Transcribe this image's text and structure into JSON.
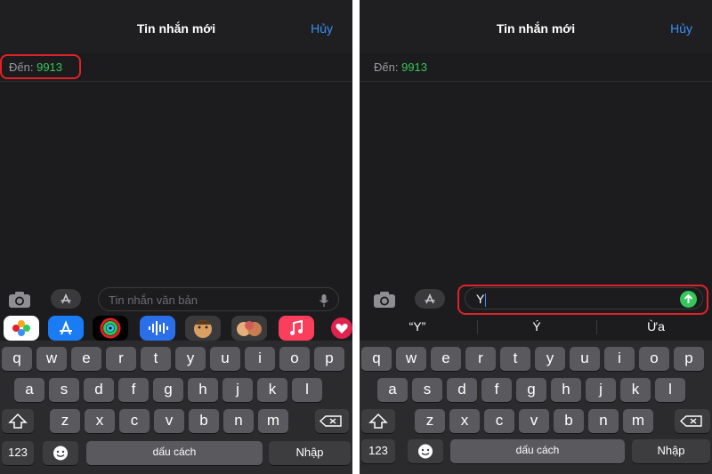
{
  "colors": {
    "accent": "#3a8ef6",
    "recipient": "#34c759",
    "highlight": "#e0222a",
    "send": "#34c759"
  },
  "left": {
    "header": {
      "title": "Tin nhắn mới",
      "cancel": "Hủy"
    },
    "to": {
      "label": "Đến:",
      "value": "9913"
    },
    "input": {
      "placeholder": "Tin nhắn văn bản"
    },
    "app_strip": [
      "photos-icon",
      "app-store-icon",
      "activity-icon",
      "audio-icon",
      "memoji-icon",
      "memoji-group-icon",
      "music-icon",
      "heart-icon"
    ],
    "keyboard": {
      "row1": [
        "q",
        "w",
        "e",
        "r",
        "t",
        "y",
        "u",
        "i",
        "o",
        "p"
      ],
      "row2": [
        "a",
        "s",
        "d",
        "f",
        "g",
        "h",
        "j",
        "k",
        "l"
      ],
      "row3": [
        "z",
        "x",
        "c",
        "v",
        "b",
        "n",
        "m"
      ],
      "numbers": "123",
      "space": "dấu cách",
      "return": "Nhập"
    }
  },
  "right": {
    "header": {
      "title": "Tin nhắn mới",
      "cancel": "Hủy"
    },
    "to": {
      "label": "Đến:",
      "value": "9913"
    },
    "input": {
      "value": "Y"
    },
    "suggestions": [
      "“Y”",
      "Ý",
      "Ừa"
    ],
    "keyboard": {
      "row1": [
        "q",
        "w",
        "e",
        "r",
        "t",
        "y",
        "u",
        "i",
        "o",
        "p"
      ],
      "row2": [
        "a",
        "s",
        "d",
        "f",
        "g",
        "h",
        "j",
        "k",
        "l"
      ],
      "row3": [
        "z",
        "x",
        "c",
        "v",
        "b",
        "n",
        "m"
      ],
      "numbers": "123",
      "space": "dấu cách",
      "return": "Nhập"
    }
  }
}
